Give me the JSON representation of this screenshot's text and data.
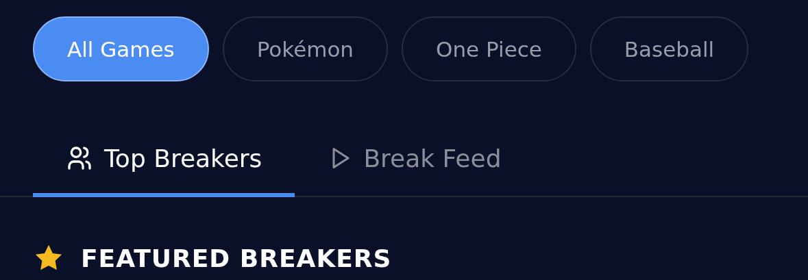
{
  "filters": [
    {
      "label": "All Games",
      "selected": true
    },
    {
      "label": "Pokémon",
      "selected": false
    },
    {
      "label": "One Piece",
      "selected": false
    },
    {
      "label": "Baseball",
      "selected": false
    }
  ],
  "tabs": [
    {
      "label": "Top Breakers",
      "selected": true,
      "kind": "users"
    },
    {
      "label": "Break Feed",
      "selected": false,
      "kind": "play"
    }
  ],
  "section": {
    "title": "FEATURED BREAKERS"
  }
}
